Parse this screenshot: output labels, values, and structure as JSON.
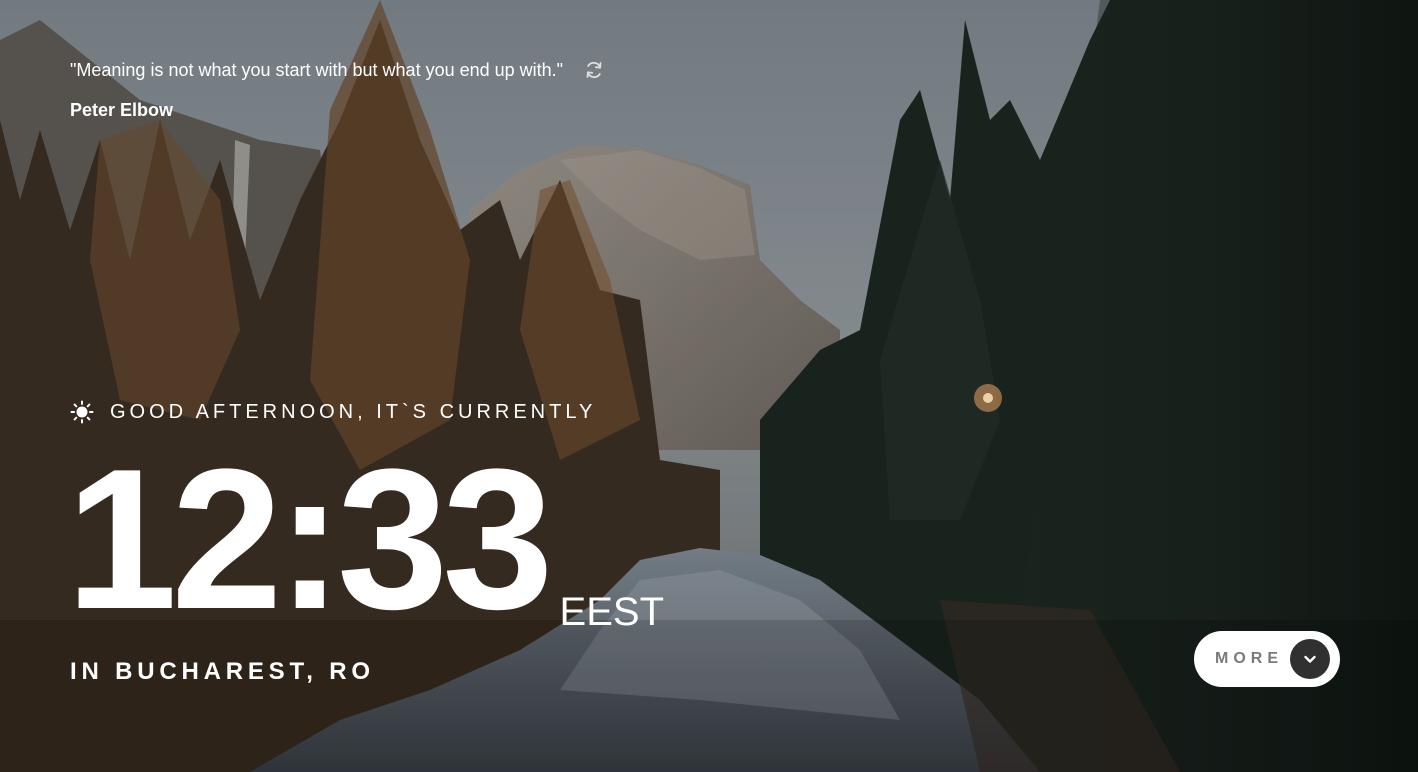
{
  "quote": {
    "text": "\"Meaning is not what you start with but what you end up with.\"",
    "author": "Peter Elbow",
    "refresh_icon": "refresh-icon"
  },
  "greeting": {
    "icon": "sun-icon",
    "text": "GOOD AFTERNOON, IT`S CURRENTLY"
  },
  "clock": {
    "time": "12:33",
    "timezone": "EEST"
  },
  "location": {
    "text": "IN BUCHAREST, RO"
  },
  "more_button": {
    "label": "MORE",
    "icon": "chevron-down-icon"
  },
  "colors": {
    "text": "#ffffff",
    "button_bg": "#ffffff",
    "button_label": "#7a7a7a",
    "button_icon_bg": "#303030"
  }
}
